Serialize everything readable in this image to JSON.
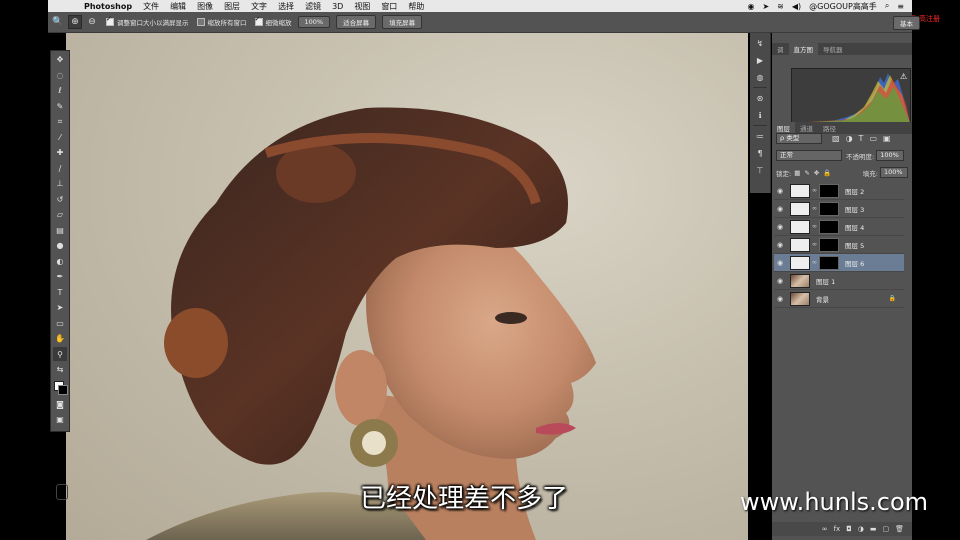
{
  "menubar": {
    "app": "Photoshop",
    "items": [
      "文件",
      "编辑",
      "图像",
      "图层",
      "文字",
      "选择",
      "滤镜",
      "3D",
      "视图",
      "窗口",
      "帮助"
    ],
    "right_user": "@GOGOUP高高手"
  },
  "watermark_top": "金银人民高高手 高注册",
  "options": {
    "chk1_label": "调整窗口大小以满屏显示",
    "chk2_label": "缩放所有窗口",
    "chk3_label": "细微缩放",
    "zoom_btn": "100%",
    "fit_btn": "适合屏幕",
    "fill_btn": "填充屏幕",
    "right_btn": "基本"
  },
  "panels": {
    "top_tabs": [
      "调",
      "直方图",
      "导航器"
    ],
    "layers_tabs": [
      "图层",
      "通道",
      "路径"
    ],
    "filter_kind": "ρ 类型",
    "blend_mode": "正常",
    "opacity_label": "不透明度:",
    "opacity_value": "100%",
    "lock_label": "锁定:",
    "fill_label": "填充:",
    "fill_value": "100%"
  },
  "layers": [
    {
      "name": "图层 2",
      "visible": true,
      "selected": false,
      "thumb": "white",
      "mask": true
    },
    {
      "name": "图层 3",
      "visible": true,
      "selected": false,
      "thumb": "white",
      "mask": true
    },
    {
      "name": "图层 4",
      "visible": true,
      "selected": false,
      "thumb": "white",
      "mask": true
    },
    {
      "name": "图层 5",
      "visible": true,
      "selected": false,
      "thumb": "white",
      "mask": true
    },
    {
      "name": "图层 6",
      "visible": true,
      "selected": true,
      "thumb": "white",
      "mask": true
    },
    {
      "name": "图层 1",
      "visible": true,
      "selected": false,
      "thumb": "photo",
      "mask": false
    },
    {
      "name": "背景",
      "visible": true,
      "selected": false,
      "thumb": "photo",
      "mask": false,
      "locked": true
    }
  ],
  "subtitle": "已经处理差不多了",
  "site": "www.hunls.com",
  "colors": {
    "accent_selected_layer": "#6b7d95",
    "panel_bg": "#535353",
    "watermark": "#ff2a2a"
  }
}
